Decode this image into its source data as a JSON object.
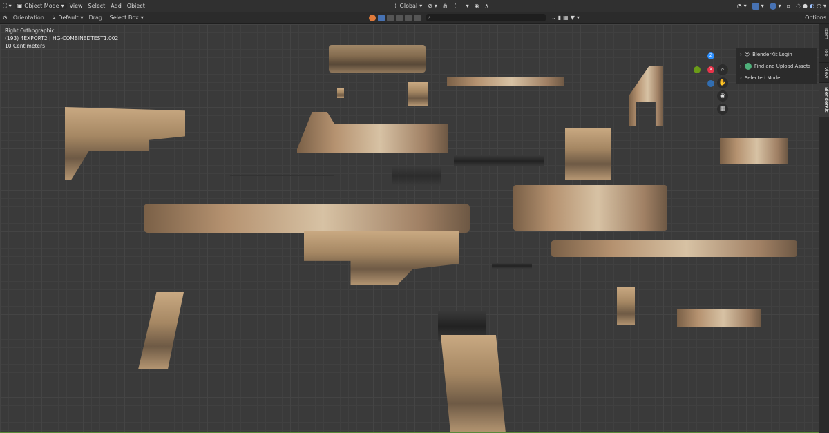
{
  "header": {
    "mode": "Object Mode",
    "menu": [
      "View",
      "Select",
      "Add",
      "Object"
    ],
    "transform": "Global",
    "options": "Options"
  },
  "tool_header": {
    "orientation_label": "Orientation:",
    "orientation_value": "Default",
    "drag_label": "Drag:",
    "drag_value": "Select Box"
  },
  "viewport_info": {
    "view": "Right Orthographic",
    "object": "(193) 4EXPORT2 | HG-COMBINEDTEST1.002",
    "scale": "10 Centimeters"
  },
  "gizmo": {
    "z": "Z",
    "y": "Y",
    "x": "X"
  },
  "npanel": {
    "items": [
      "BlenderKit Login",
      "Find and Upload Assets",
      "Selected Model"
    ]
  },
  "tabs": [
    "Item",
    "Tool",
    "View",
    "BlenderKit"
  ],
  "colors": {
    "x_axis": "#e8334a",
    "y_axis": "#8bdc00",
    "z_axis": "#2c8fff",
    "accent": "#4772b3"
  }
}
